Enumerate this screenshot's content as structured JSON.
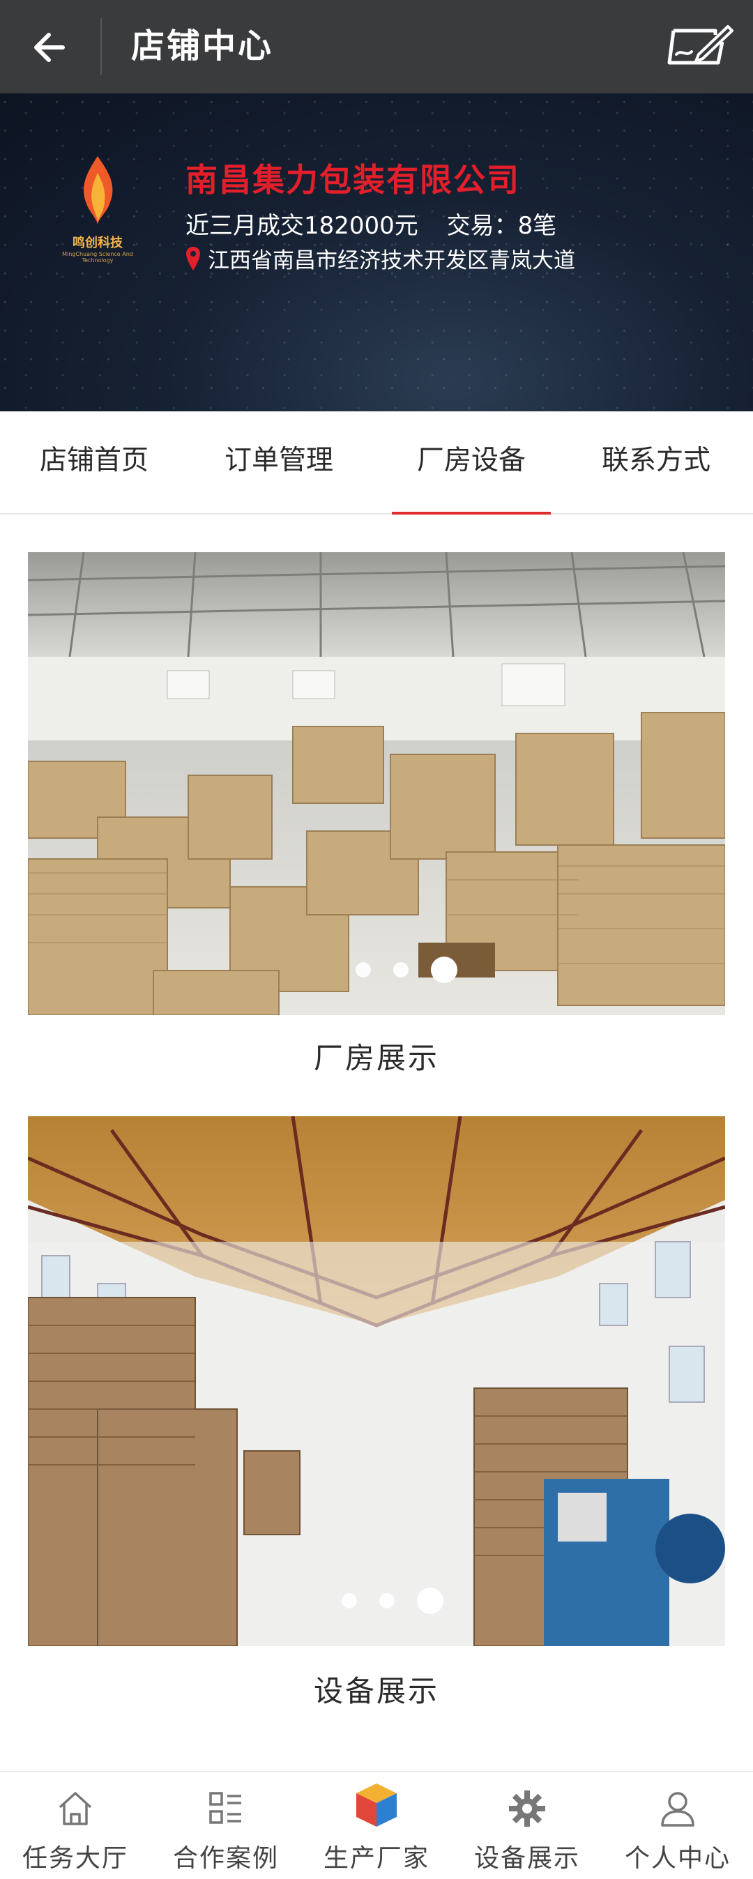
{
  "appbar": {
    "title": "店铺中心"
  },
  "shop": {
    "logo_text": "鸣创科技",
    "logo_sub": "MingChuang Science And Technology",
    "name": "南昌集力包装有限公司",
    "stats_volume": "近三月成交182000元",
    "stats_trades": "交易：8笔",
    "address": "江西省南昌市经济技术开发区青岚大道",
    "name_color": "#e21f2a"
  },
  "tabs": [
    {
      "label": "店铺首页",
      "active": false
    },
    {
      "label": "订单管理",
      "active": false
    },
    {
      "label": "厂房设备",
      "active": true
    },
    {
      "label": "联系方式",
      "active": false
    }
  ],
  "sections": [
    {
      "caption": "厂房展示",
      "image": "warehouse-photo",
      "dots": 3,
      "active_dot": 3
    },
    {
      "caption": "设备展示",
      "image": "equipment-photo",
      "dots": 3,
      "active_dot": 3
    }
  ],
  "bottom_nav": [
    {
      "label": "任务大厅",
      "icon": "home-icon",
      "active": false
    },
    {
      "label": "合作案例",
      "icon": "list-grid-icon",
      "active": false
    },
    {
      "label": "生产厂家",
      "icon": "cube-icon",
      "active": true
    },
    {
      "label": "设备展示",
      "icon": "gear-icon",
      "active": false
    },
    {
      "label": "个人中心",
      "icon": "person-icon",
      "active": false
    }
  ],
  "colors": {
    "appbar_bg": "#3a3b3d",
    "accent": "#e02b2b"
  }
}
